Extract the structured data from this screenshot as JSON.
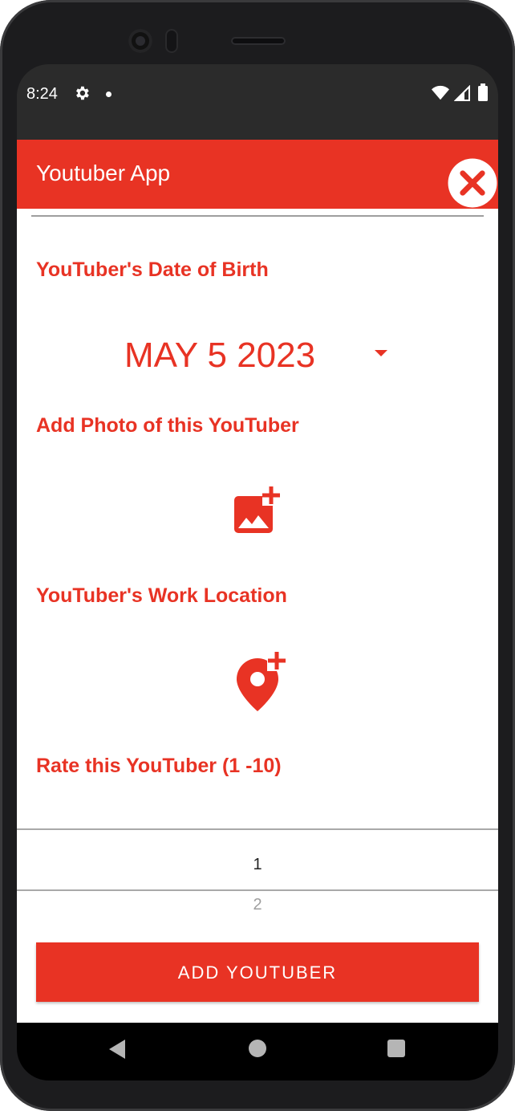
{
  "status_bar": {
    "time": "8:24",
    "icons": [
      "gear-icon",
      "dot-icon",
      "wifi-icon",
      "signal-icon",
      "battery-icon"
    ]
  },
  "app_bar": {
    "title": "Youtuber App",
    "close_icon": "close-circle-icon"
  },
  "form": {
    "dob_label": "YouTuber's Date of Birth",
    "dob_value": "MAY 5 2023",
    "photo_label": "Add Photo of this YouTuber",
    "photo_icon": "add-photo-icon",
    "location_label": "YouTuber's Work Location",
    "location_icon": "add-location-icon",
    "rating_label": "Rate this YouTuber (1 -10)",
    "rating_selected": "1",
    "rating_next": "2",
    "submit_label": "ADD YOUTUBER"
  },
  "nav_bar": {
    "icons": [
      "back-icon",
      "home-icon",
      "recents-icon"
    ]
  },
  "colors": {
    "accent": "#e83324",
    "status_bar": "#2b2b2b",
    "nav_bar": "#000000"
  }
}
